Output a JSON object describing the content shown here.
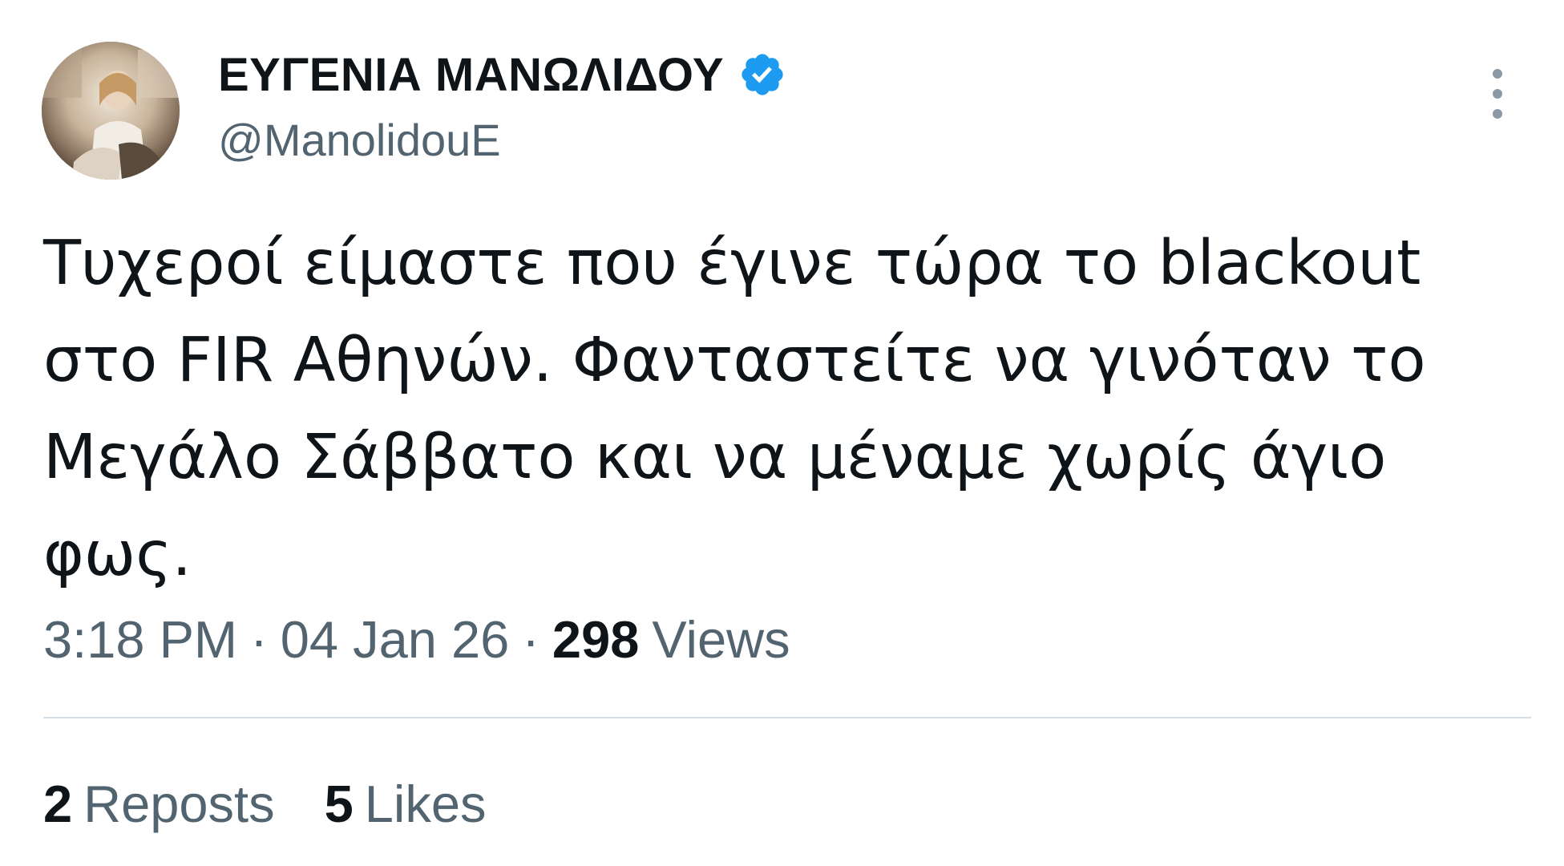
{
  "author": {
    "display_name": "ΕΥΓΕΝΙΑ ΜΑΝΩΛΙΔΟΥ",
    "handle": "@ManolidouE",
    "verified": true,
    "verified_color": "#1d9bf0",
    "avatar_icon": "profile-photo"
  },
  "tweet": {
    "text": "Τυχεροί είμαστε που έγινε τώρα το blackout\nστο FIR Αθηνών. Φανταστείτε να γινόταν το\nΜεγάλο Σάββατο και να μέναμε χωρίς άγιο\nφως."
  },
  "meta": {
    "time": "3:18 PM",
    "separator": "·",
    "date": "04 Jan 26",
    "views_count": "298",
    "views_label": "Views"
  },
  "stats": {
    "reposts_count": "2",
    "reposts_label": "Reposts",
    "likes_count": "5",
    "likes_label": "Likes"
  },
  "colors": {
    "text_primary": "#0f1419",
    "text_secondary": "#536471",
    "divider": "#d6dfe6"
  }
}
